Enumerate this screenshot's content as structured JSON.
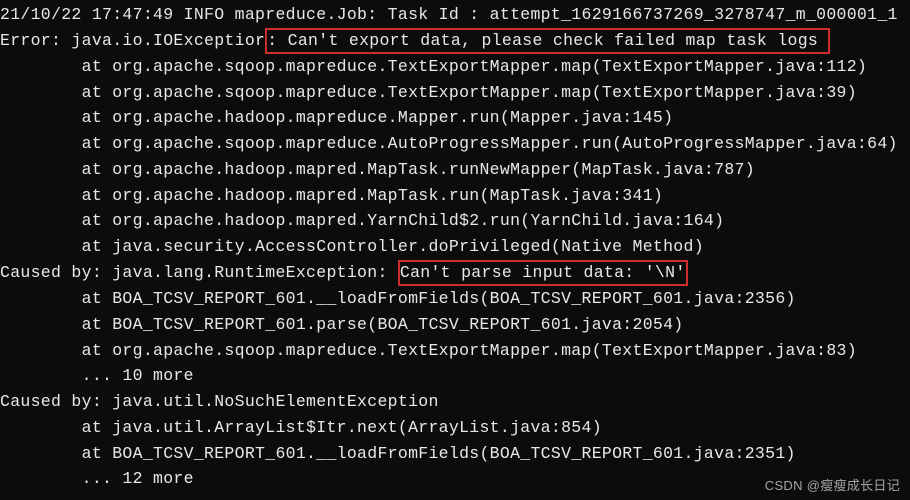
{
  "lines": {
    "l0": "21/10/22 17:47:49 INFO mapreduce.Job: Task Id : attempt_1629166737269_3278747_m_000001_1",
    "l1a": "Error: java.io.IOExceptior",
    "l1b": ": Can't export data, please check failed map task logs ",
    "l2": "        at org.apache.sqoop.mapreduce.TextExportMapper.map(TextExportMapper.java:112)",
    "l3": "        at org.apache.sqoop.mapreduce.TextExportMapper.map(TextExportMapper.java:39)",
    "l4": "        at org.apache.hadoop.mapreduce.Mapper.run(Mapper.java:145)",
    "l5": "        at org.apache.sqoop.mapreduce.AutoProgressMapper.run(AutoProgressMapper.java:64)",
    "l6": "        at org.apache.hadoop.mapred.MapTask.runNewMapper(MapTask.java:787)",
    "l7": "        at org.apache.hadoop.mapred.MapTask.run(MapTask.java:341)",
    "l8": "        at org.apache.hadoop.mapred.YarnChild$2.run(YarnChild.java:164)",
    "l9": "        at java.security.AccessController.doPrivileged(Native Method)",
    "l10a": "Caused by: java.lang.RuntimeException: ",
    "l10b": "Can't parse input data: '\\N'",
    "l11": "        at BOA_TCSV_REPORT_601.__loadFromFields(BOA_TCSV_REPORT_601.java:2356)",
    "l12": "        at BOA_TCSV_REPORT_601.parse(BOA_TCSV_REPORT_601.java:2054)",
    "l13": "        at org.apache.sqoop.mapreduce.TextExportMapper.map(TextExportMapper.java:83)",
    "l14": "        ... 10 more",
    "l15": "Caused by: java.util.NoSuchElementException",
    "l16": "        at java.util.ArrayList$Itr.next(ArrayList.java:854)",
    "l17": "        at BOA_TCSV_REPORT_601.__loadFromFields(BOA_TCSV_REPORT_601.java:2351)",
    "l18": "        ... 12 more"
  },
  "watermark": "CSDN @瘦瘦成长日记"
}
